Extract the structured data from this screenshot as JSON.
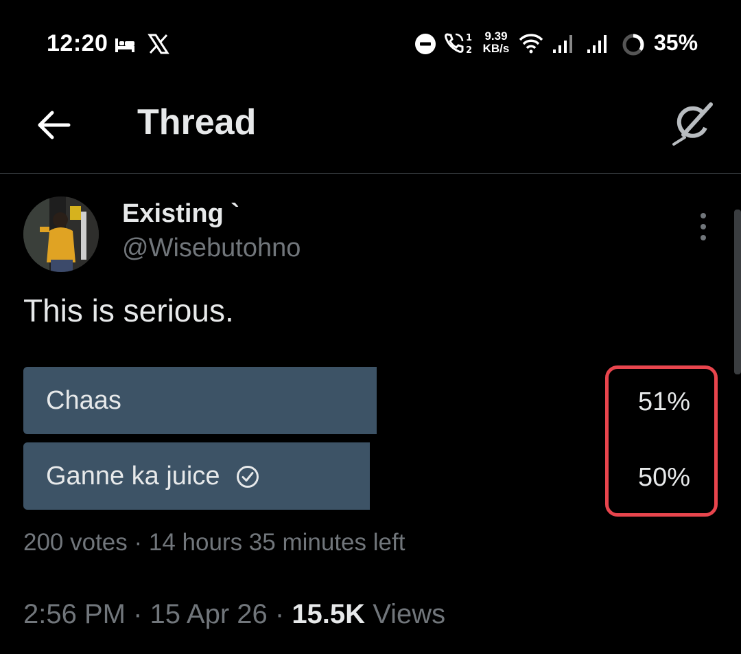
{
  "status_bar": {
    "time": "12:20",
    "net_speed_value": "9.39",
    "net_speed_unit": "KB/s",
    "battery": "35%",
    "icons": [
      "sleep-icon",
      "x-logo-icon",
      "do-not-disturb-icon",
      "volte-call-icon",
      "wifi-icon",
      "signal-sim1-icon",
      "signal-sim2-icon",
      "battery-ring-icon"
    ]
  },
  "header": {
    "title": "Thread",
    "back_icon": "arrow-left-icon",
    "action_icon": "grok-icon"
  },
  "post": {
    "display_name": "Existing `",
    "handle": "@Wisebutohno",
    "text": "This is serious.",
    "poll": {
      "options": [
        {
          "label": "Chaas",
          "percent_text": "51%",
          "share": 0.51,
          "selected": false
        },
        {
          "label": "Ganne ka juice",
          "percent_text": "50%",
          "share": 0.5,
          "selected": true
        }
      ],
      "meta": "200 votes · 14 hours 35 minutes left"
    },
    "time": "2:56 PM",
    "date": "15 Apr 26",
    "views_count": "15.5K",
    "views_label": "Views"
  },
  "colors": {
    "background": "#000000",
    "poll_bar": "#3d5366",
    "muted_text": "#71767b",
    "highlight": "#e8454d"
  }
}
